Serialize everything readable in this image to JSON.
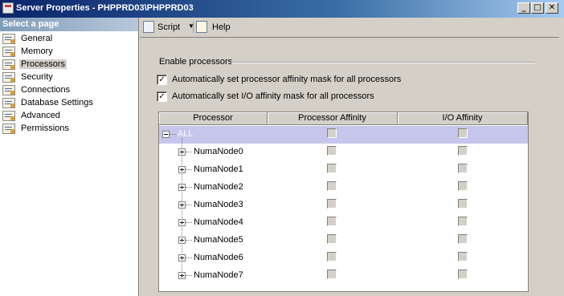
{
  "window": {
    "title": "Server Properties - PHPPRD03\\PHPPRD03",
    "minimize_glyph": "_",
    "maximize_glyph": "□",
    "close_glyph": "✕"
  },
  "sidebar": {
    "header": "Select a page",
    "items": [
      {
        "label": "General",
        "icon": "page-icon"
      },
      {
        "label": "Memory",
        "icon": "page-icon"
      },
      {
        "label": "Processors",
        "icon": "page-icon",
        "selected": true
      },
      {
        "label": "Security",
        "icon": "page-icon"
      },
      {
        "label": "Connections",
        "icon": "page-icon"
      },
      {
        "label": "Database Settings",
        "icon": "page-icon"
      },
      {
        "label": "Advanced",
        "icon": "page-icon"
      },
      {
        "label": "Permissions",
        "icon": "page-icon"
      }
    ]
  },
  "toolbar": {
    "script_label": "Script",
    "script_dropdown": "▼",
    "help_label": "Help"
  },
  "processors": {
    "group_title": "Enable processors",
    "auto_processor_affinity": {
      "label": "Automatically set processor affinity mask for all processors",
      "checked": true,
      "mark": "✓"
    },
    "auto_io_affinity": {
      "label": "Automatically set I/O affinity mask for all processors",
      "checked": true,
      "mark": "✓"
    },
    "grid": {
      "columns": [
        "Processor",
        "Processor Affinity",
        "I/O Affinity"
      ],
      "rows": [
        {
          "name": "ALL",
          "expanded": true,
          "selected": true
        },
        {
          "name": "NumaNode0",
          "expanded": false
        },
        {
          "name": "NumaNode1",
          "expanded": false
        },
        {
          "name": "NumaNode2",
          "expanded": false
        },
        {
          "name": "NumaNode3",
          "expanded": false
        },
        {
          "name": "NumaNode4",
          "expanded": false
        },
        {
          "name": "NumaNode5",
          "expanded": false
        },
        {
          "name": "NumaNode6",
          "expanded": false
        },
        {
          "name": "NumaNode7",
          "expanded": false
        }
      ]
    }
  },
  "colors": {
    "selected_row": "#c6c6ec",
    "title_bar": "#0a246a",
    "selected_row_text": "#ffffff"
  }
}
